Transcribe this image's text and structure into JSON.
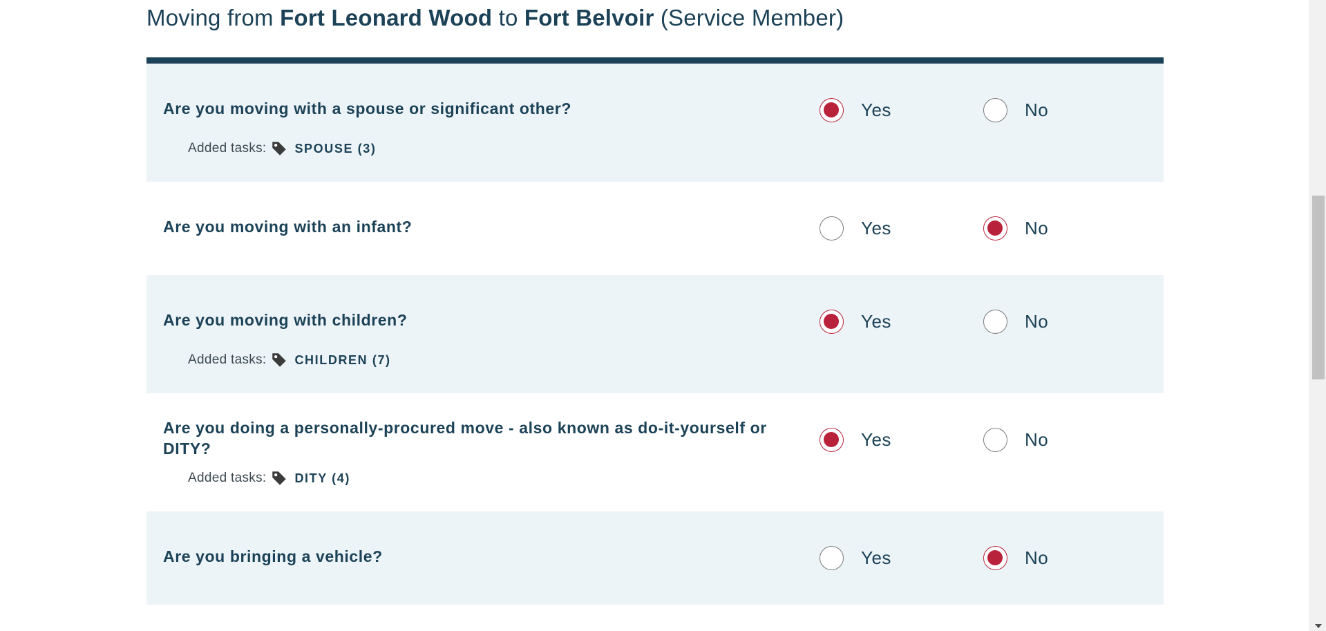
{
  "heading": {
    "prefix": "Moving from",
    "origin": "Fort Leonard Wood",
    "connector": "to",
    "destination": "Fort Belvoir",
    "role": "(Service Member)"
  },
  "colors": {
    "primary": "#1c4257",
    "accent_selected": "#b8223a",
    "row_shade": "#edf4f8"
  },
  "questions": [
    {
      "text": "Are you moving with a spouse or significant other?",
      "selected": "yes",
      "yes_label": "Yes",
      "no_label": "No",
      "added_label": "Added tasks:",
      "tag": "SPOUSE (3)"
    },
    {
      "text": "Are you moving with an infant?",
      "selected": "no",
      "yes_label": "Yes",
      "no_label": "No"
    },
    {
      "text": "Are you moving with children?",
      "selected": "yes",
      "yes_label": "Yes",
      "no_label": "No",
      "added_label": "Added tasks:",
      "tag": "CHILDREN (7)"
    },
    {
      "text": "Are you doing a personally-procured move - also known as do-it-yourself or DITY?",
      "selected": "yes",
      "yes_label": "Yes",
      "no_label": "No",
      "added_label": "Added tasks:",
      "tag": "DITY (4)"
    },
    {
      "text": "Are you bringing a vehicle?",
      "selected": "no",
      "yes_label": "Yes",
      "no_label": "No"
    }
  ],
  "icons": {
    "tag": "tag-icon"
  }
}
